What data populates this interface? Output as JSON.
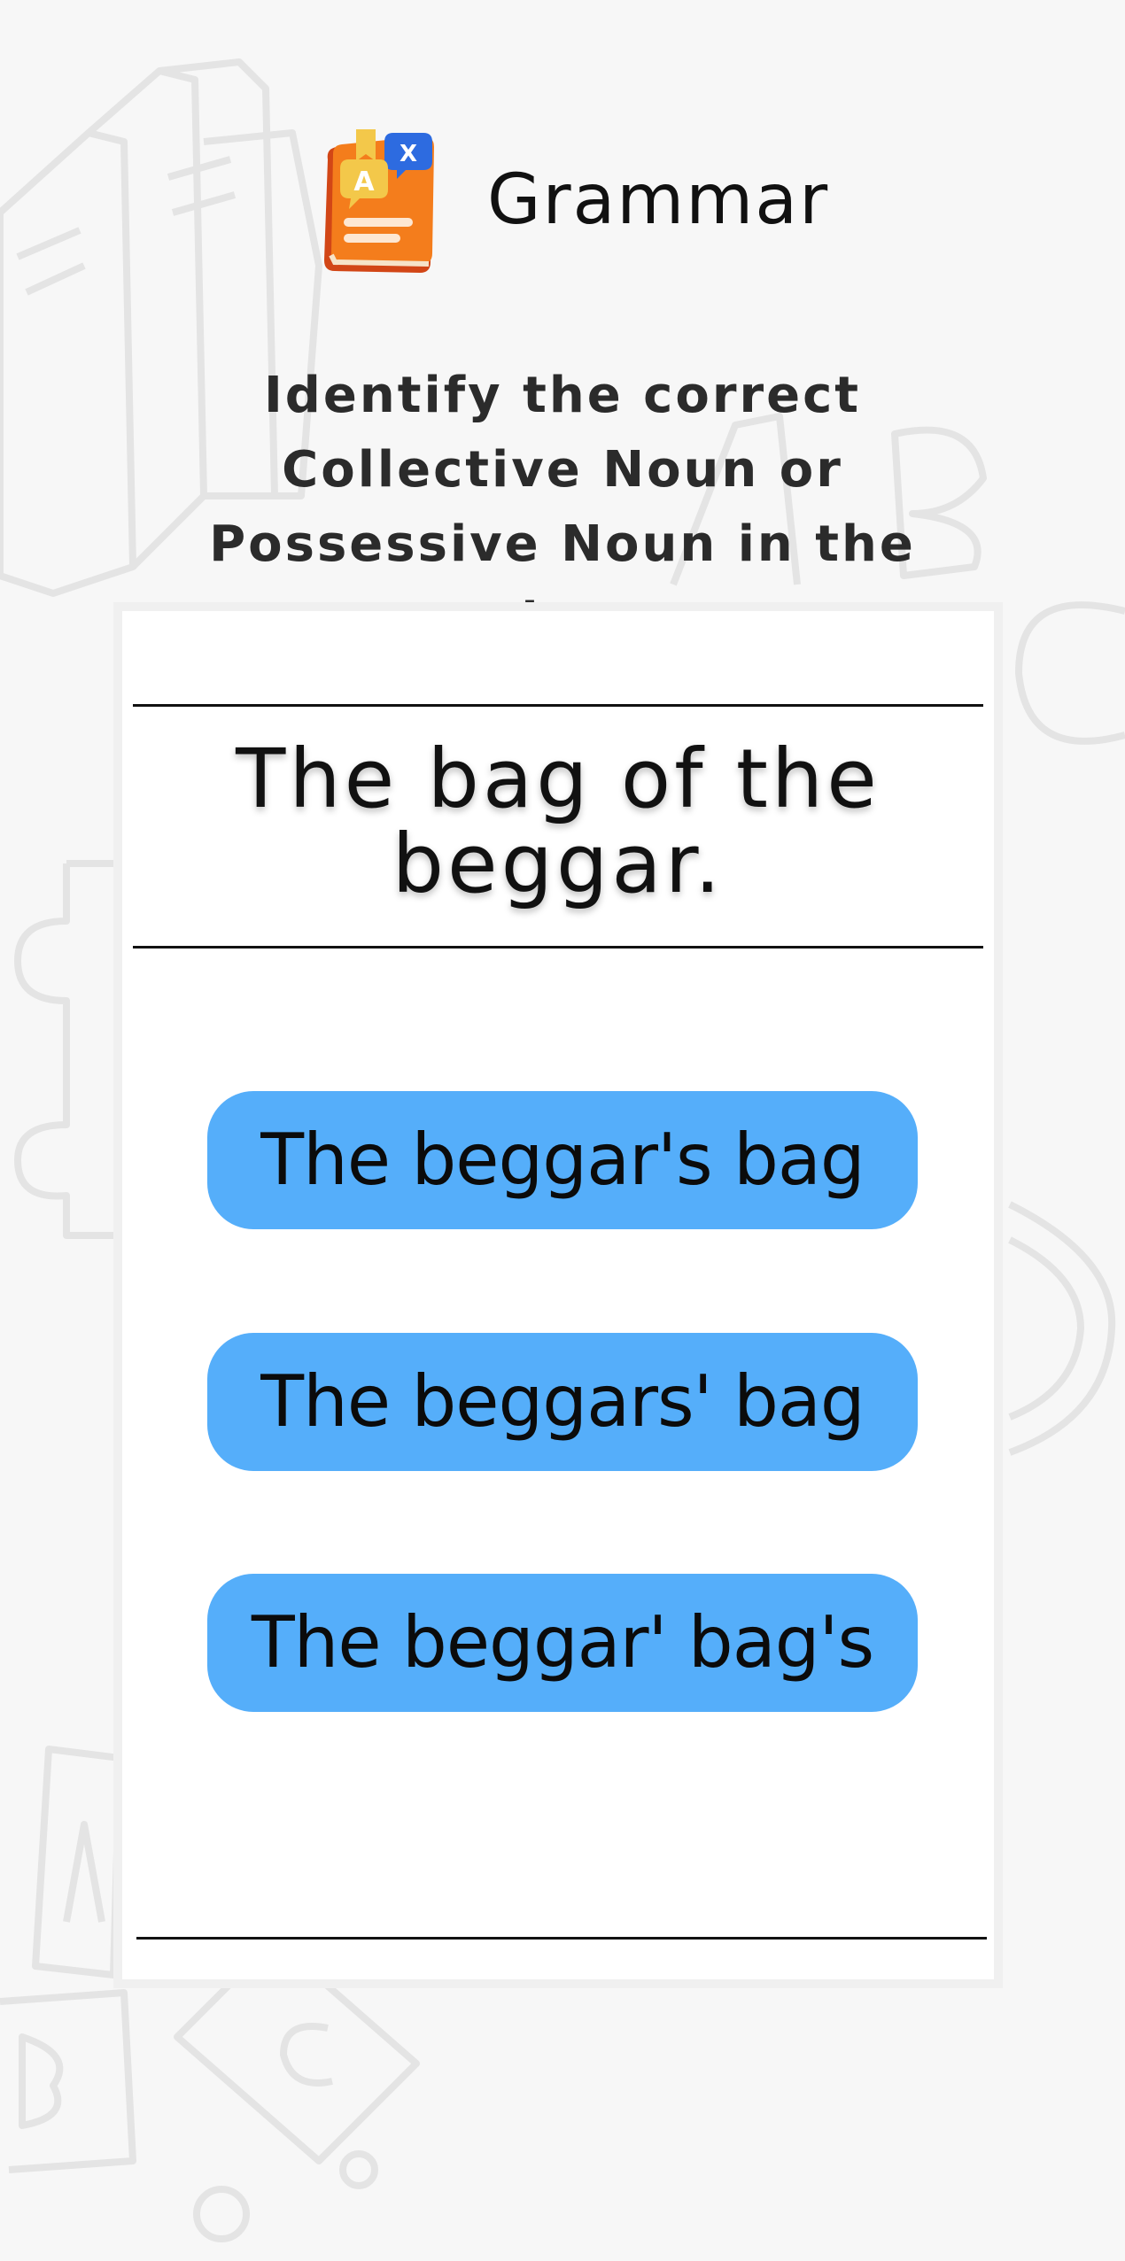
{
  "app": {
    "title": "Grammar",
    "logo_icon": "grammar-book-icon"
  },
  "question": {
    "instruction": "Identify the correct Collective Noun or Possessive Noun in the sentence.",
    "sentence": "The bag of the beggar."
  },
  "options": [
    {
      "label": "The beggar's bag"
    },
    {
      "label": "The beggars' bag"
    },
    {
      "label": "The beggar' bag's"
    }
  ],
  "colors": {
    "option_background": "#55aefa",
    "background": "#f7f7f7",
    "card": "#ffffff"
  }
}
